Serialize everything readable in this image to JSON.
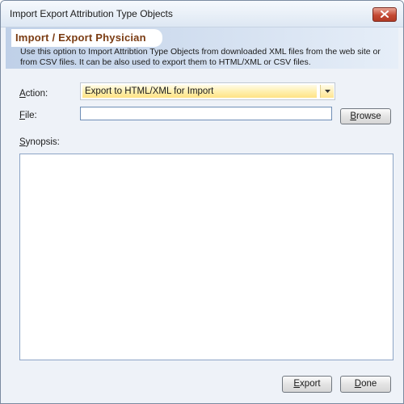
{
  "window": {
    "title": "Import Export Attribution Type Objects"
  },
  "header": {
    "title": "Import / Export Physician",
    "description": "Use this option to Import Attribtion Type Objects from downloaded XML files from the web site or from CSV files. It can be also used to export them to HTML/XML or CSV files."
  },
  "form": {
    "action_label_first": "A",
    "action_label_rest": "ction:",
    "action_value": "Export to HTML/XML for Import",
    "file_label_first": "F",
    "file_label_rest": "ile:",
    "file_value": "",
    "browse_label_first": "B",
    "browse_label_rest": "rowse",
    "synopsis_label_first": "S",
    "synopsis_label_rest": "ynopsis:",
    "synopsis_value": ""
  },
  "footer": {
    "export_label_first": "E",
    "export_label_rest": "xport",
    "done_label_first": "D",
    "done_label_rest": "one"
  },
  "icons": {
    "close": "close-icon",
    "dropdown": "chevron-down-icon"
  },
  "colors": {
    "header_title": "#7a3b12",
    "close_button": "#c44a34",
    "selection_highlight": "#ffe385"
  }
}
